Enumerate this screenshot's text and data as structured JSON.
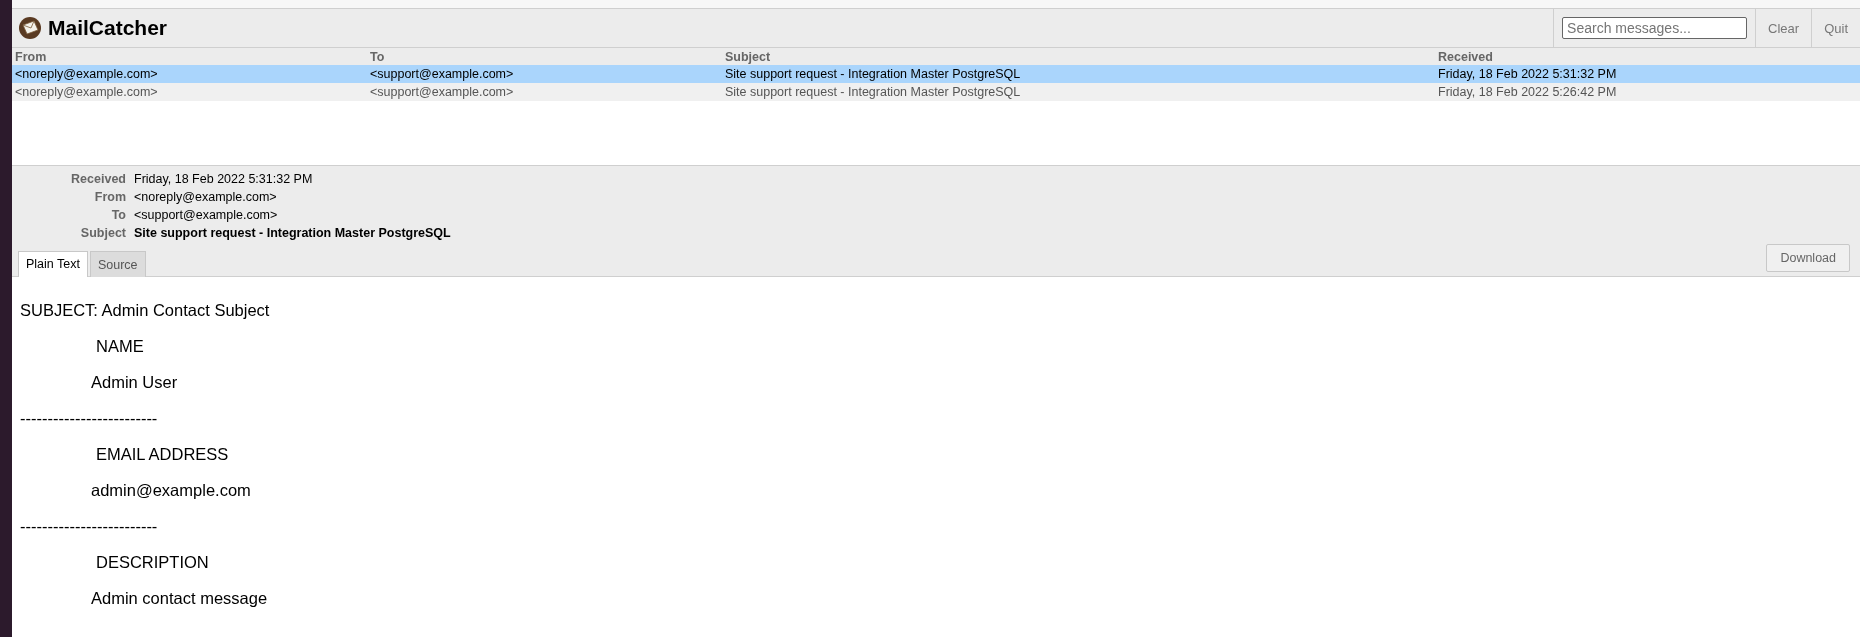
{
  "app": {
    "title": "MailCatcher"
  },
  "search": {
    "placeholder": "Search messages..."
  },
  "actions": [
    "Clear",
    "Quit"
  ],
  "list": {
    "columns": [
      "From",
      "To",
      "Subject",
      "Received"
    ],
    "rows": [
      {
        "selected": true,
        "cells": [
          "<noreply@example.com>",
          "<support@example.com>",
          "Site support request - Integration Master PostgreSQL",
          "Friday, 18 Feb 2022 5:31:32 PM"
        ]
      },
      {
        "selected": false,
        "cells": [
          "<noreply@example.com>",
          "<support@example.com>",
          "Site support request - Integration Master PostgreSQL",
          "Friday, 18 Feb 2022 5:26:42 PM"
        ]
      }
    ]
  },
  "details": [
    {
      "label": "Received",
      "value": "Friday, 18 Feb 2022 5:31:32 PM",
      "kind": "plain"
    },
    {
      "label": "From",
      "value": "<noreply@example.com>",
      "kind": "plain"
    },
    {
      "label": "To",
      "value": "<support@example.com>",
      "kind": "plain"
    },
    {
      "label": "Subject",
      "value": "Site support request - Integration Master PostgreSQL",
      "kind": "strong"
    }
  ],
  "tabs": [
    {
      "label": "Plain Text",
      "selected": true
    },
    {
      "label": "Source",
      "selected": false
    }
  ],
  "download": "Download",
  "body": [
    {
      "kind": "line",
      "text": "SUBJECT: Admin Contact Subject"
    },
    {
      "kind": "heading",
      "text": "NAME"
    },
    {
      "kind": "value",
      "text": "Admin User"
    },
    {
      "kind": "line",
      "text": "-------------------------"
    },
    {
      "kind": "heading",
      "text": "EMAIL ADDRESS"
    },
    {
      "kind": "value",
      "text": "admin@example.com"
    },
    {
      "kind": "line",
      "text": "-------------------------"
    },
    {
      "kind": "heading",
      "text": "DESCRIPTION"
    },
    {
      "kind": "value",
      "text": "Admin contact message"
    }
  ]
}
